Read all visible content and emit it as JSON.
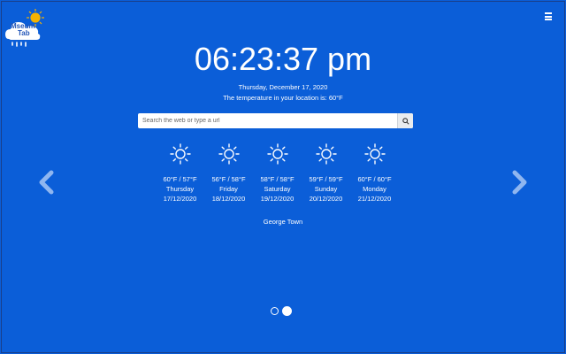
{
  "logo": {
    "line1": "Mseum",
    "line2": "Tab",
    "icon": "cloud-sun-rain-logo"
  },
  "menu": {
    "icon": "hamburger-menu-icon"
  },
  "clock": {
    "time": "06:23:37 pm"
  },
  "date_text": "Thursday, December 17, 2020",
  "temperature_text": "The temperature in your location is: 60°F",
  "search": {
    "placeholder": "Search the web or type a url",
    "icon": "search-icon"
  },
  "forecast": [
    {
      "temps": "60°F / 57°F",
      "day": "Thursday",
      "date": "17/12/2020",
      "icon": "sun-icon"
    },
    {
      "temps": "56°F / 58°F",
      "day": "Friday",
      "date": "18/12/2020",
      "icon": "sun-icon"
    },
    {
      "temps": "58°F / 58°F",
      "day": "Saturday",
      "date": "19/12/2020",
      "icon": "sun-icon"
    },
    {
      "temps": "59°F / 59°F",
      "day": "Sunday",
      "date": "20/12/2020",
      "icon": "sun-icon"
    },
    {
      "temps": "60°F / 60°F",
      "day": "Monday",
      "date": "21/12/2020",
      "icon": "sun-icon"
    }
  ],
  "city": "George Town",
  "navigation": {
    "prev_icon": "chevron-left-icon",
    "next_icon": "chevron-right-icon"
  },
  "pagination": {
    "total": 2,
    "active_index": 1
  },
  "colors": {
    "background": "#0b5ed8",
    "text": "#ffffff",
    "arrow": "#8fb6f0"
  }
}
